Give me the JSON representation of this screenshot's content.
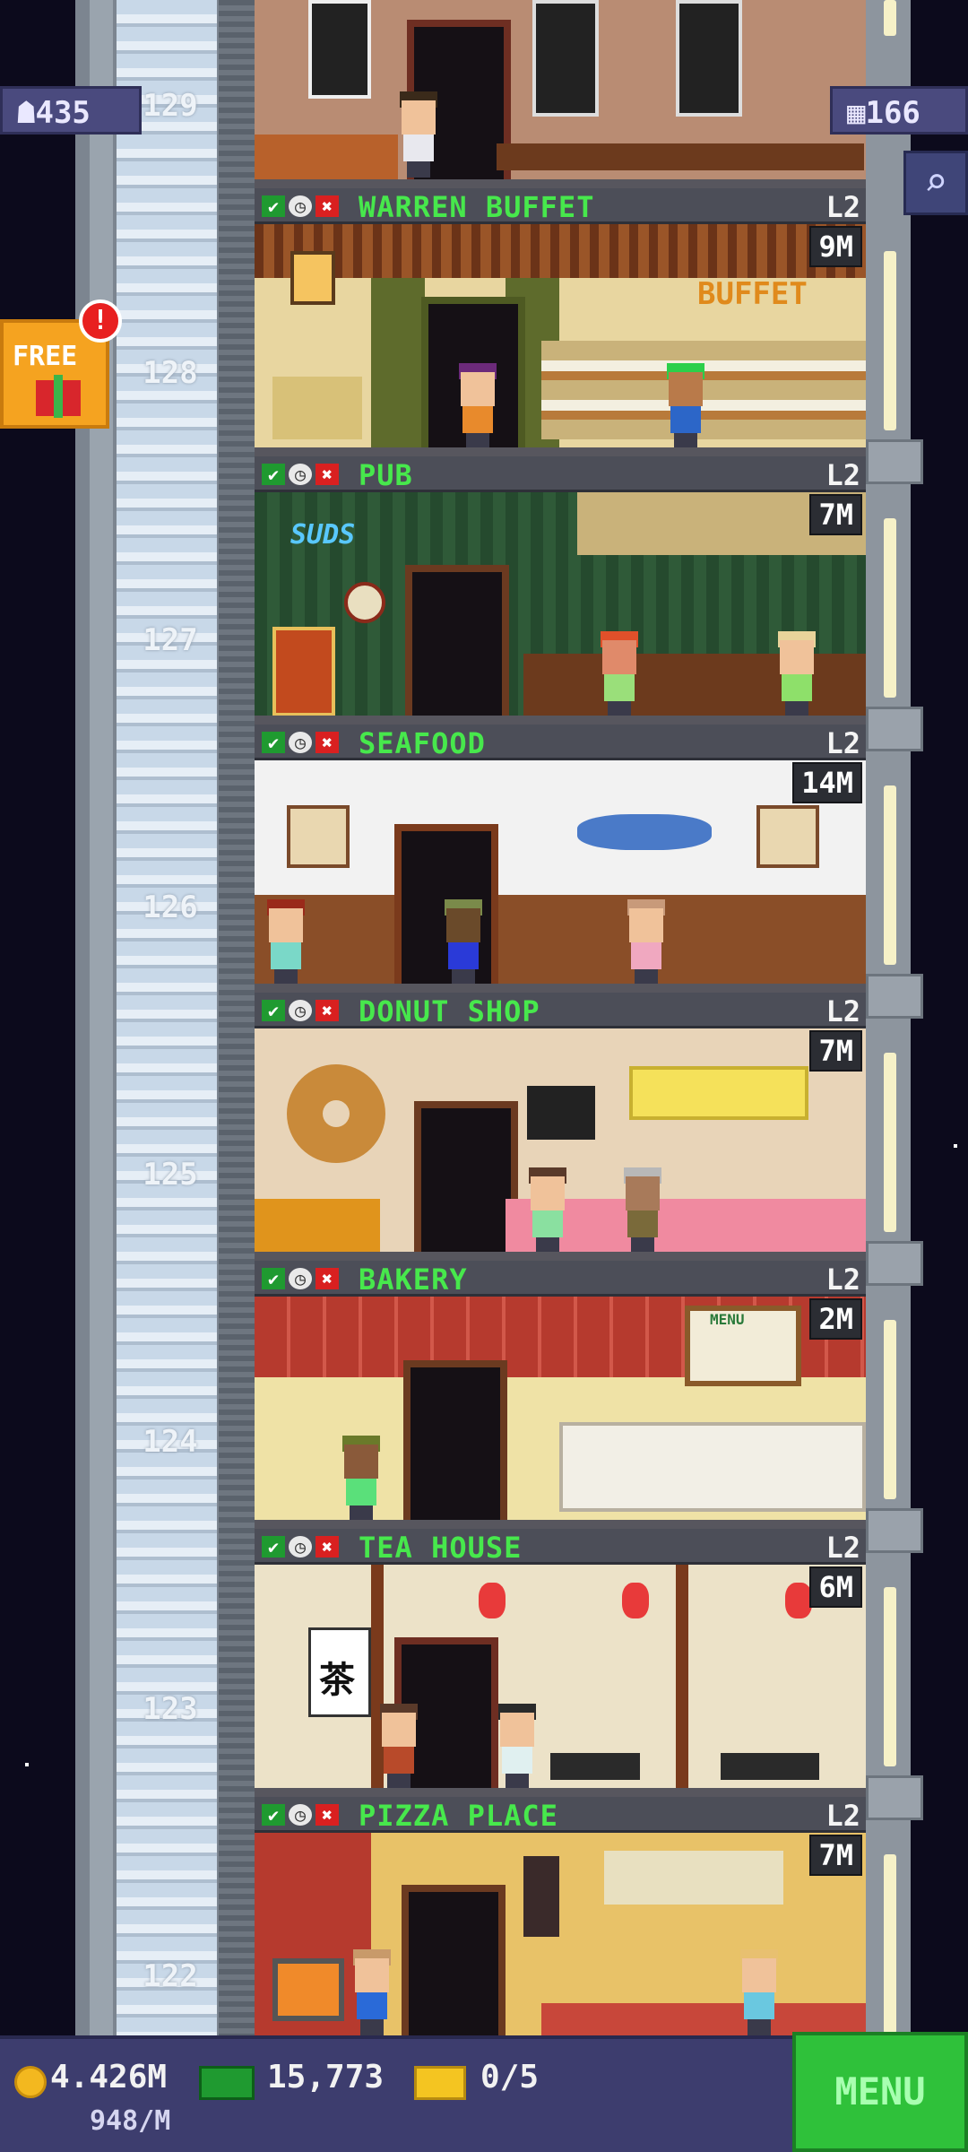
{
  "hud": {
    "population": "435",
    "floors_count": "166",
    "free_label": "FREE",
    "alert": "!"
  },
  "floors": [
    {
      "number": "128",
      "name": "WARREN BUFFET",
      "level": "L2",
      "income": "9M",
      "sign": "BUFFET"
    },
    {
      "number": "127",
      "name": "PUB",
      "level": "L2",
      "income": "7M",
      "sign": "SUDS"
    },
    {
      "number": "126",
      "name": "SEAFOOD",
      "level": "L2",
      "income": "14M"
    },
    {
      "number": "125",
      "name": "DONUT SHOP",
      "level": "L2",
      "income": "7M"
    },
    {
      "number": "124",
      "name": "BAKERY",
      "level": "L2",
      "income": "2M",
      "sign": "MENU"
    },
    {
      "number": "123",
      "name": "TEA HOUSE",
      "level": "L2",
      "income": "6M",
      "sign": "茶"
    },
    {
      "number": "122",
      "name": "PIZZA PLACE",
      "level": "L2",
      "income": "7M"
    }
  ],
  "top_floor_number": "129",
  "bottom_bar": {
    "coins": "4.426M",
    "rate": "948/M",
    "bux": "15,773",
    "tickets": "0/5",
    "menu_label": "MENU"
  },
  "colors": {
    "accent_green": "#47e84c",
    "hud_purple": "#4a4a7e",
    "menu_green": "#2fc13a"
  }
}
